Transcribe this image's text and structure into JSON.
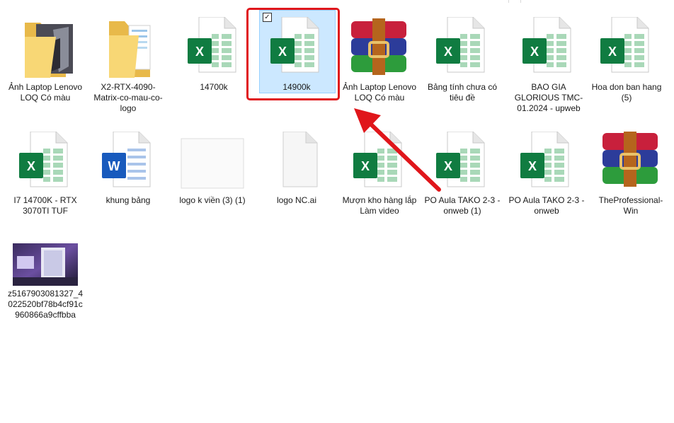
{
  "files": [
    {
      "label": "Ảnh Laptop Lenovo LOQ Có màu",
      "type": "folder-photo"
    },
    {
      "label": "X2-RTX-4090-Matrix-co-mau-co-logo",
      "type": "folder-docs"
    },
    {
      "label": "14700k",
      "type": "excel"
    },
    {
      "label": "14900k",
      "type": "excel",
      "selected": true
    },
    {
      "label": "Ảnh Laptop Lenovo LOQ Có màu",
      "type": "winrar"
    },
    {
      "label": "Bảng tính chưa có tiêu đề",
      "type": "excel"
    },
    {
      "label": "BAO GIA GLORIOUS TMC-01.2024 - upweb",
      "type": "excel"
    },
    {
      "label": "Hoa don ban hang (5)",
      "type": "excel"
    },
    {
      "label": "I7 14700K - RTX 3070TI TUF",
      "type": "excel"
    },
    {
      "label": "khung bảng",
      "type": "word"
    },
    {
      "label": "logo k viền (3) (1)",
      "type": "blank-image"
    },
    {
      "label": "logo NC.ai",
      "type": "generic-file"
    },
    {
      "label": "Mượn kho hàng lắp Làm video",
      "type": "excel"
    },
    {
      "label": "PO Aula TAKO 2-3 - onweb (1)",
      "type": "excel"
    },
    {
      "label": "PO Aula TAKO 2-3 - onweb",
      "type": "excel"
    },
    {
      "label": "TheProfessional-Win",
      "type": "winrar"
    },
    {
      "label": "z5167903081327_4022520bf78b4cf91c960866a9cffbba",
      "type": "photo"
    }
  ],
  "annotation": {
    "color": "#e0161b",
    "target": "14900k"
  },
  "colors": {
    "excel": "#107c41",
    "word": "#185abd",
    "selection": "#cce8ff",
    "folder": "#f8d775"
  }
}
